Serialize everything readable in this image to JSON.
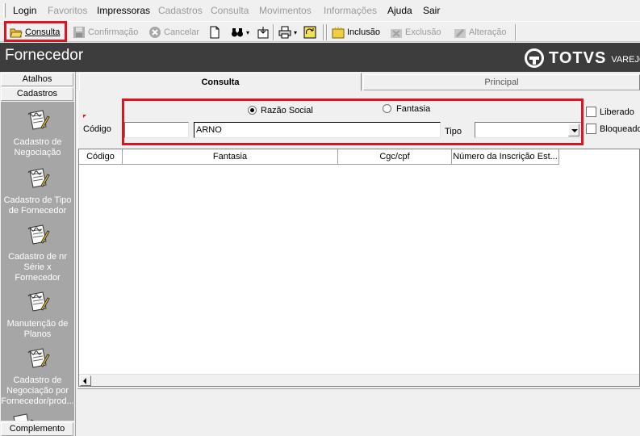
{
  "menu": {
    "items": [
      {
        "label": "Login",
        "enabled": true
      },
      {
        "label": "Favoritos",
        "enabled": false
      },
      {
        "label": "Impressoras",
        "enabled": true
      },
      {
        "label": "Cadastros",
        "enabled": false
      },
      {
        "label": "Consulta",
        "enabled": false
      },
      {
        "label": "Movimentos",
        "enabled": false
      },
      {
        "label": "Informações",
        "enabled": false
      },
      {
        "label": "Ajuda",
        "enabled": true
      },
      {
        "label": "Sair",
        "enabled": true
      }
    ]
  },
  "toolbar": {
    "consulta_label": "Consulta",
    "confirmacao_label": "Confirmação",
    "cancelar_label": "Cancelar",
    "inclusao_label": "Inclusão",
    "exclusao_label": "Exclusão",
    "alteracao_label": "Alteração"
  },
  "window": {
    "title": "Fornecedor",
    "brand": "TOTVS",
    "brand_sub": "VAREJO"
  },
  "sidebar": {
    "atalhos_label": "Atalhos",
    "cadastros_label": "Cadastros",
    "complemento_label": "Complemento",
    "items": [
      {
        "label": "Cadastro de Negociação"
      },
      {
        "label": "Cadastro de Tipo de Fornecedor"
      },
      {
        "label": "Cadastro de nr Série x Fornecedor"
      },
      {
        "label": "Manutenção de Planos"
      },
      {
        "label": "Cadastro de Negociação por Fornecedor/prod..."
      }
    ]
  },
  "tabs": {
    "consulta": "Consulta",
    "principal": "Principal"
  },
  "form": {
    "radio_razao_social": "Razão Social",
    "radio_fantasia": "Fantasia",
    "selected_radio": "Razão Social",
    "codigo_label": "Código",
    "codigo_value": "",
    "nome_value": "ARNO",
    "tipo_label": "Tipo",
    "tipo_value": "",
    "liberado_label": "Liberado",
    "bloqueado_label": "Bloqueado"
  },
  "grid": {
    "columns": [
      "Código",
      "Fantasia",
      "Cgc/cpf",
      "Número da Inscrição Est..."
    ]
  },
  "colors": {
    "highlight": "#e0141e",
    "titlebar": "#3d3d3d",
    "sidebar_panel": "#a6a6a6"
  }
}
